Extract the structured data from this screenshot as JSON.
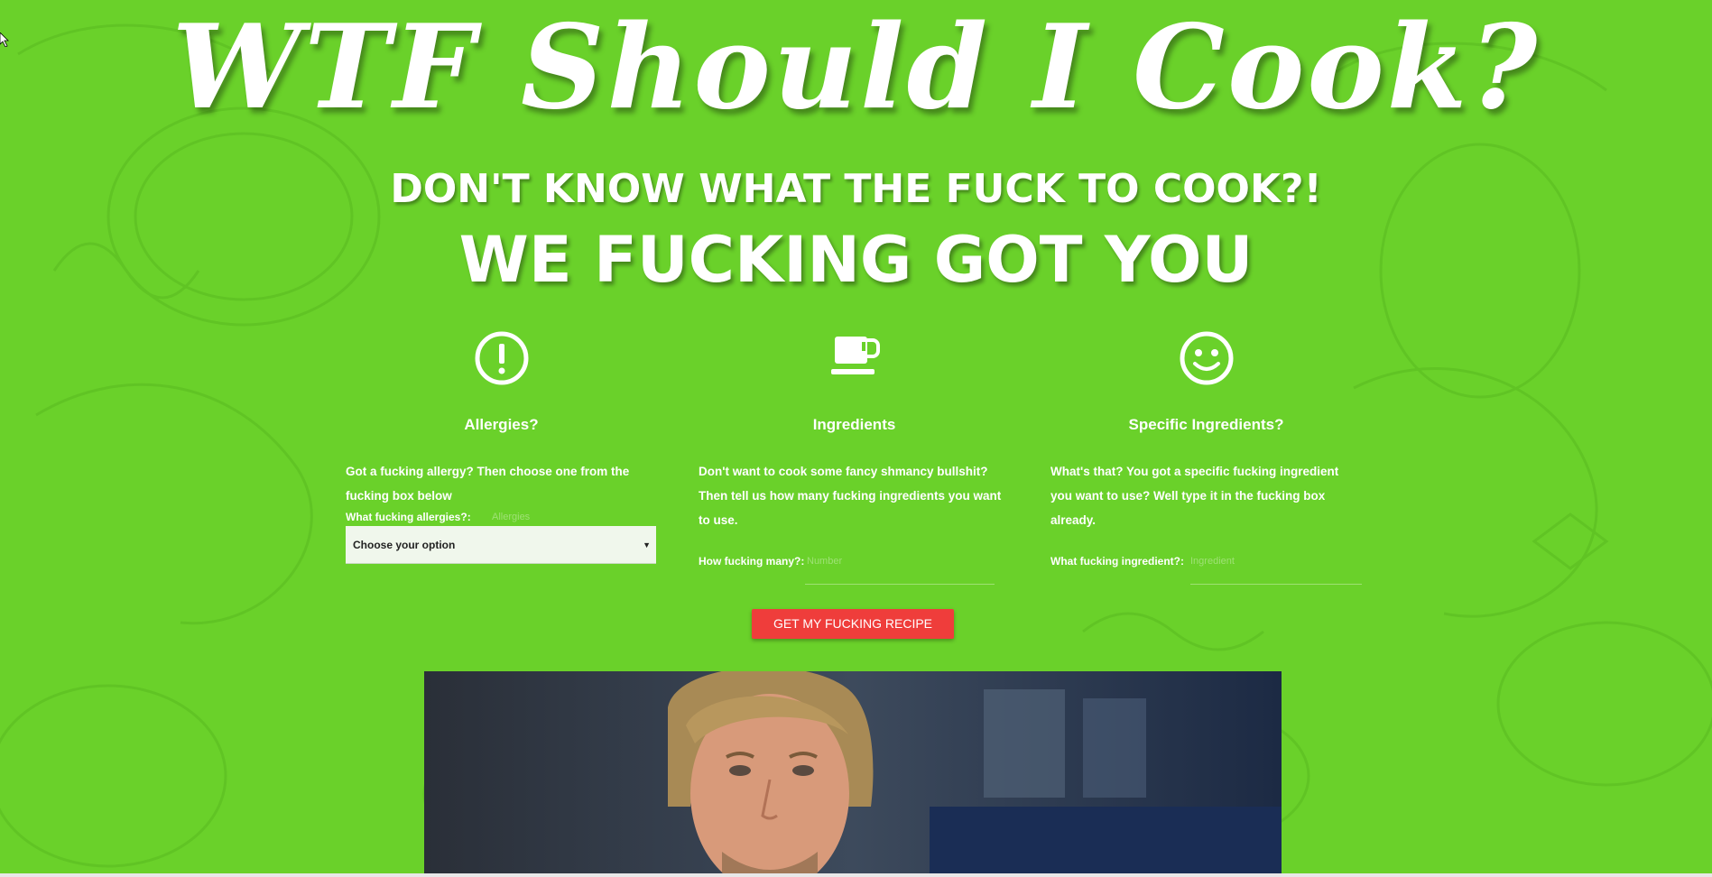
{
  "page": {
    "title": "WTF Should I Cook?",
    "headline_1": "DON'T KNOW WHAT THE FUCK TO COOK?!",
    "headline_2": "WE FUCKING GOT YOU"
  },
  "features": [
    {
      "icon": "exclamation-circle-icon",
      "title": "Allergies?",
      "text": "Got a fucking allergy? Then choose one from the fucking box below",
      "field_label": "What fucking allergies?:",
      "field_placeholder": "Allergies",
      "select_value": "Choose your option"
    },
    {
      "icon": "coffee-cup-icon",
      "title": "Ingredients",
      "text": "Don't want to cook some fancy shmancy bullshit? Then tell us how many fucking ingredients you want to use.",
      "field_label": "How fucking many?:",
      "field_placeholder": "Number"
    },
    {
      "icon": "smiley-face-icon",
      "title": "Specific Ingredients?",
      "text": "What's that? You got a specific fucking ingredient you want to use? Well type it in the fucking box already.",
      "field_label": "What fucking ingredient?:",
      "field_placeholder": "Ingredient"
    }
  ],
  "cta": {
    "label": "GET MY FUCKING RECIPE"
  },
  "colors": {
    "background": "#6ad12a",
    "button": "#ef3d3b",
    "text": "#ffffff"
  }
}
